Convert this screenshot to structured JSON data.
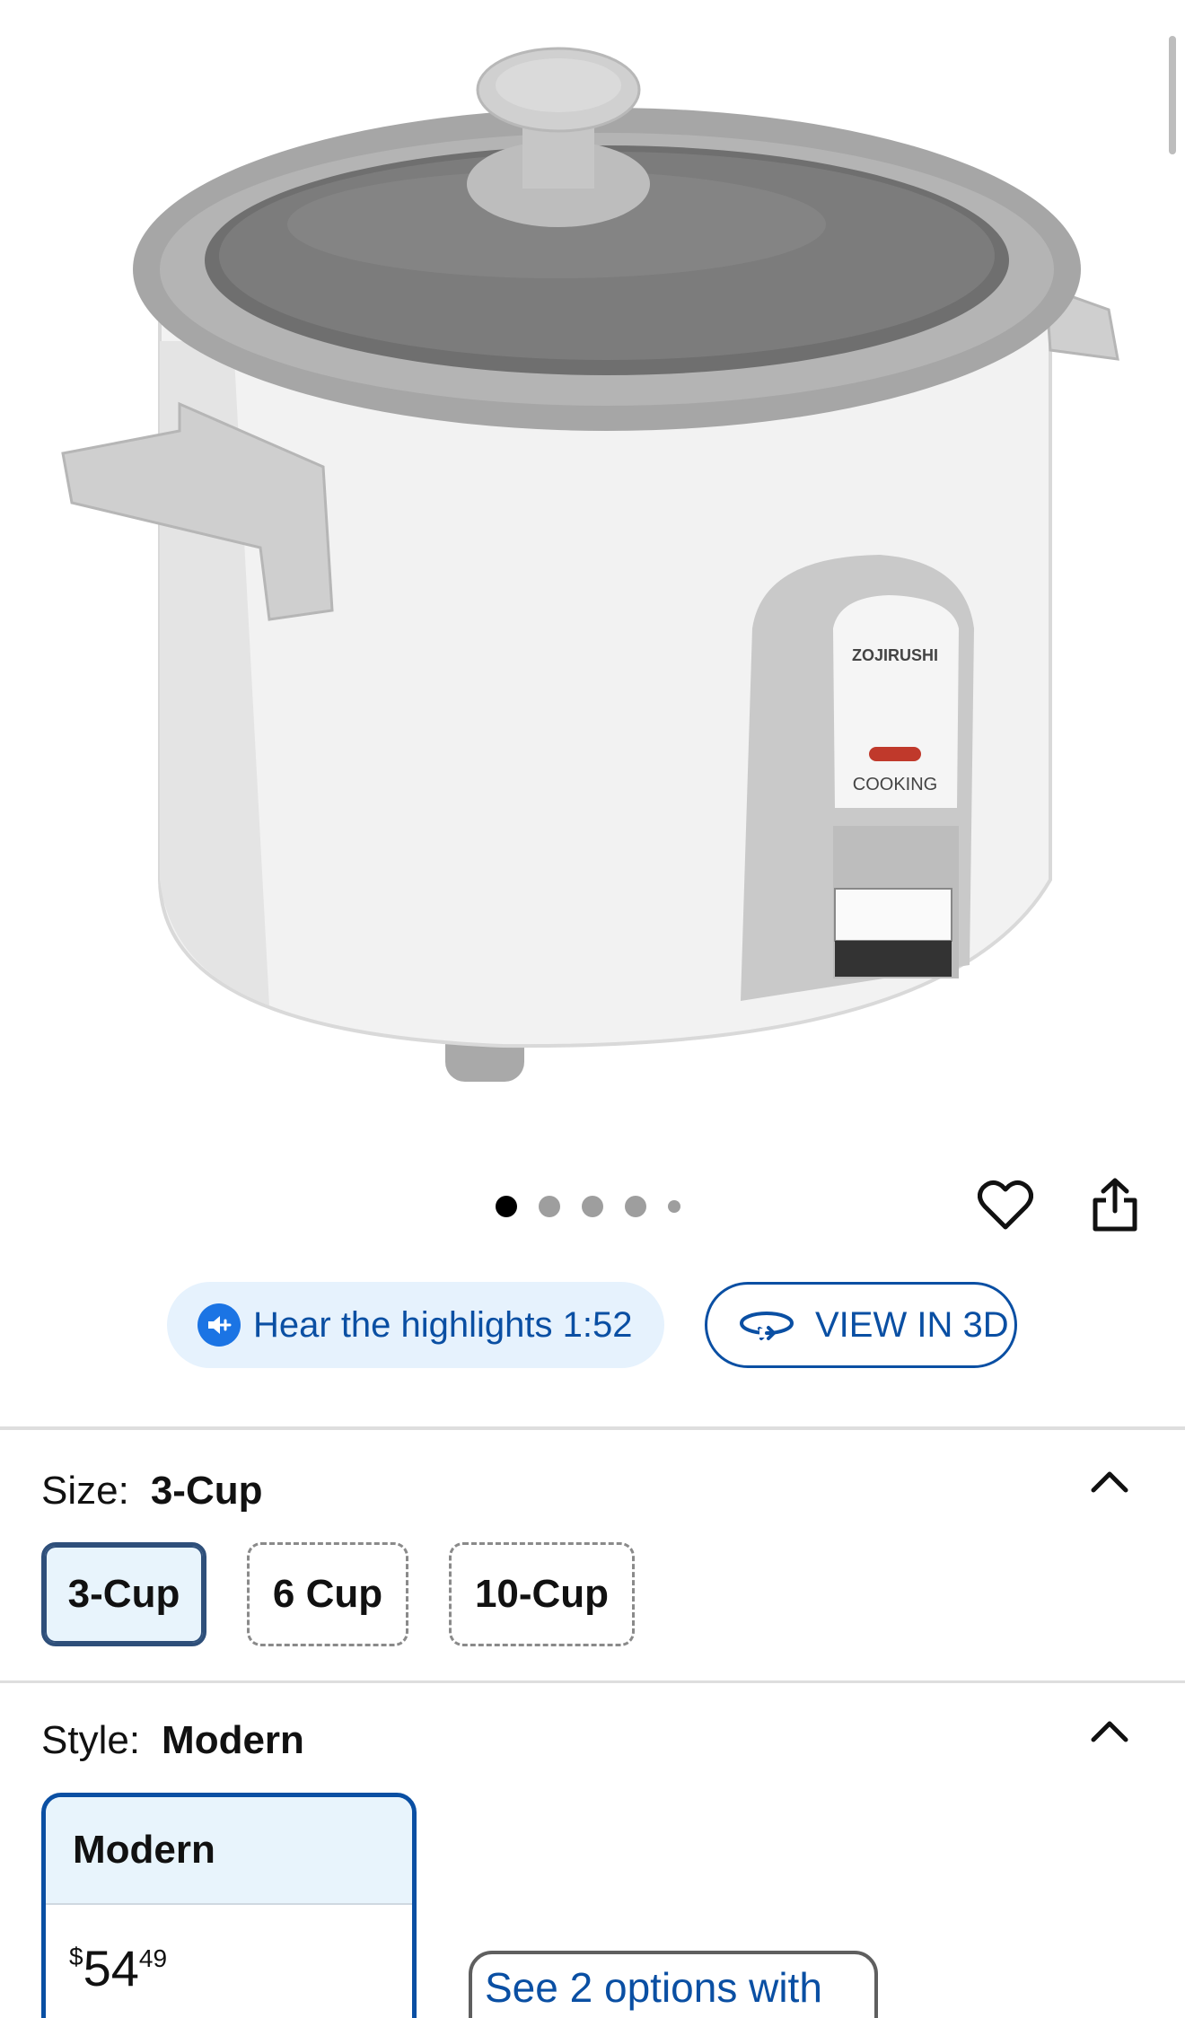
{
  "product": {
    "image_alt": "Zojirushi 3-Cup rice cooker, white with gray lid",
    "brand_mark": "ZOJIRUSHI",
    "status_label": "COOKING"
  },
  "carousel": {
    "dot_count": 5,
    "active_index": 0
  },
  "actions": {
    "favorite_icon": "heart-outline-icon",
    "share_icon": "share-icon"
  },
  "media_buttons": {
    "hear_highlights": "Hear the highlights 1:52",
    "view_in_3d": "VIEW IN 3D"
  },
  "size": {
    "label": "Size:",
    "selected": "3-Cup",
    "options": [
      "3-Cup",
      "6 Cup",
      "10-Cup"
    ]
  },
  "style": {
    "label": "Style:",
    "selected": "Modern",
    "card": {
      "name": "Modern",
      "currency": "$",
      "dollars": "54",
      "cents": "49"
    },
    "options_button": "See 2 options with"
  },
  "colors": {
    "link_blue": "#0a4fa3",
    "selected_bg": "#e8f4fc",
    "pill_bg": "#e6f2fd"
  }
}
